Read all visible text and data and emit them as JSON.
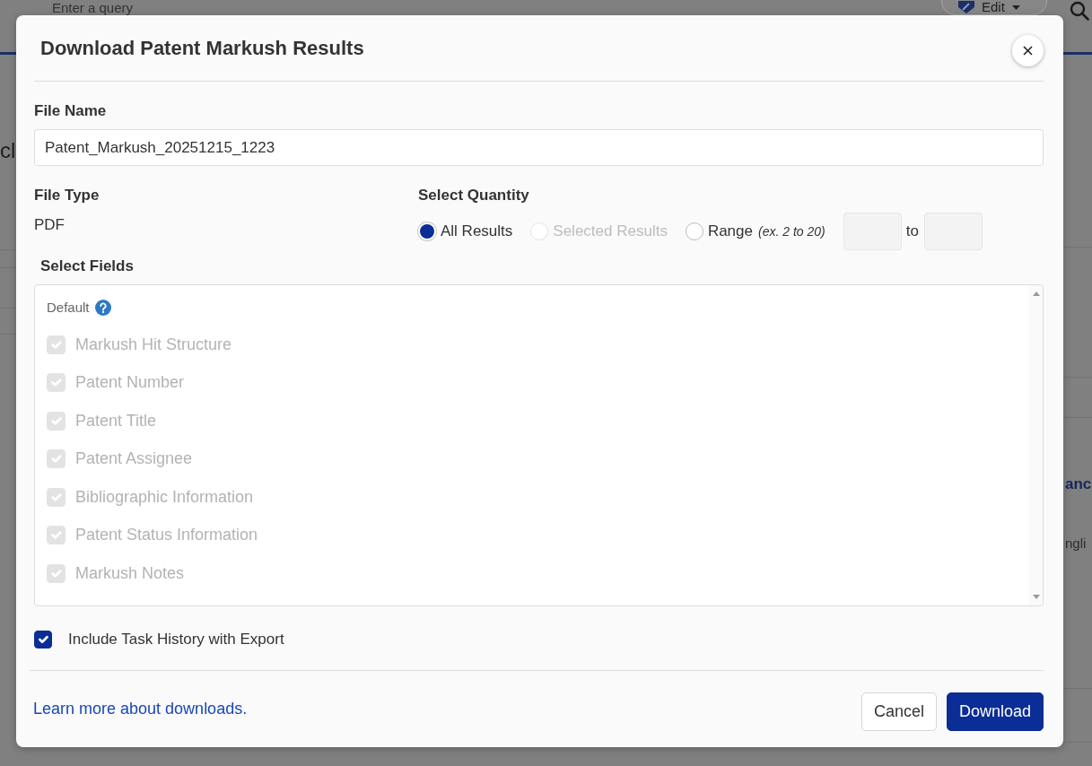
{
  "background": {
    "search": {
      "placeholder": "Enter a query"
    },
    "edit_button": {
      "label": "Edit"
    },
    "left_fragments": [
      "cl"
    ],
    "right_fragments": [
      {
        "text": "anc",
        "kind": "heading"
      },
      {
        "text": "ngli",
        "kind": "body"
      }
    ]
  },
  "dialog": {
    "title": "Download Patent Markush Results",
    "file_name": {
      "label": "File Name",
      "value": "Patent_Markush_20251215_1223"
    },
    "file_type": {
      "label": "File Type",
      "value": "PDF"
    },
    "quantity": {
      "label": "Select Quantity",
      "options": [
        {
          "label": "All Results",
          "kind": "all",
          "selected": true,
          "disabled": false
        },
        {
          "label": "Selected Results",
          "kind": "selected",
          "selected": false,
          "disabled": true
        },
        {
          "label": "Range",
          "hint": "(ex. 2 to 20)",
          "kind": "range",
          "selected": false,
          "disabled": false
        }
      ],
      "range_separator": "to"
    },
    "fields": {
      "label": "Select Fields",
      "group": "Default",
      "items": [
        {
          "label": "Markush Hit Structure",
          "checked": true,
          "disabled": true
        },
        {
          "label": "Patent Number",
          "checked": true,
          "disabled": true
        },
        {
          "label": "Patent Title",
          "checked": true,
          "disabled": true
        },
        {
          "label": "Patent Assignee",
          "checked": true,
          "disabled": true
        },
        {
          "label": "Bibliographic Information",
          "checked": true,
          "disabled": true
        },
        {
          "label": "Patent Status Information",
          "checked": true,
          "disabled": true
        },
        {
          "label": "Markush Notes",
          "checked": true,
          "disabled": true
        }
      ]
    },
    "include_history": {
      "label": "Include Task History with Export",
      "checked": true
    },
    "learn_more_link": "Learn more about downloads.",
    "buttons": [
      {
        "label": "Cancel",
        "kind": "secondary"
      },
      {
        "label": "Download",
        "kind": "primary"
      }
    ]
  }
}
